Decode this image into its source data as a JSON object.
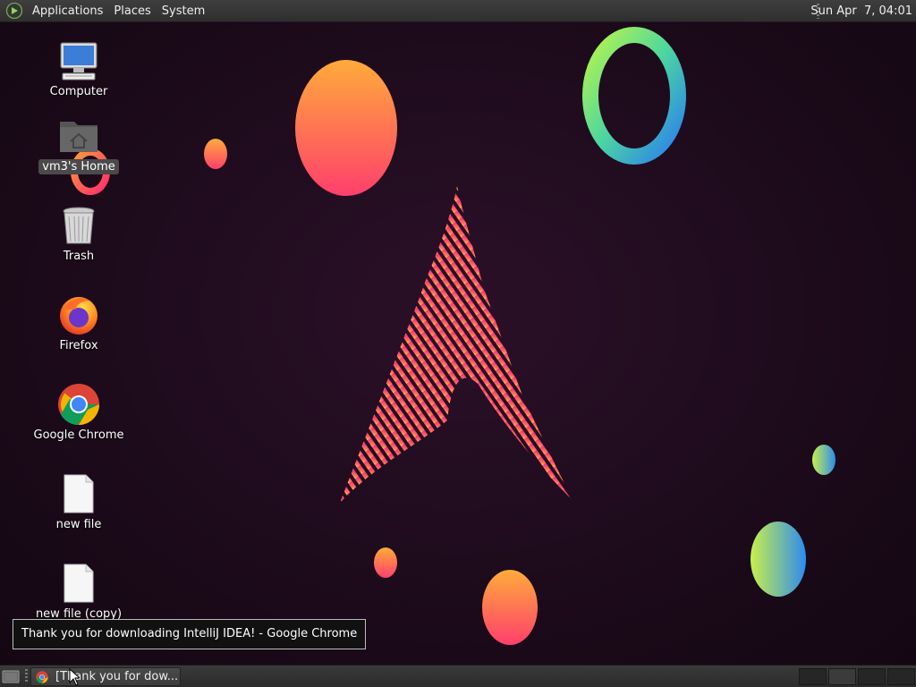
{
  "top_panel": {
    "menus": [
      "Applications",
      "Places",
      "System"
    ],
    "clock": "Sun Apr  7, 04:01"
  },
  "desktop_icons": [
    {
      "label": "Computer",
      "icon": "computer-icon"
    },
    {
      "label": "vm3's Home",
      "icon": "home-folder-icon",
      "selected": true
    },
    {
      "label": "Trash",
      "icon": "trash-icon"
    },
    {
      "label": "Firefox",
      "icon": "firefox-icon"
    },
    {
      "label": "Google Chrome",
      "icon": "chrome-icon"
    },
    {
      "label": "new file",
      "icon": "file-icon"
    },
    {
      "label": "new file (copy)",
      "icon": "file-icon"
    }
  ],
  "tooltip": {
    "text": "Thank you for downloading IntelliJ IDEA! - Google Chrome"
  },
  "taskbar": {
    "tasks": [
      {
        "label": "[Thank you for dow...",
        "icon": "chrome-icon"
      }
    ],
    "workspaces": 4,
    "active_workspace": 2
  },
  "colors": {
    "panel": "#333333",
    "desktop_bg": "#1d0b1c"
  }
}
